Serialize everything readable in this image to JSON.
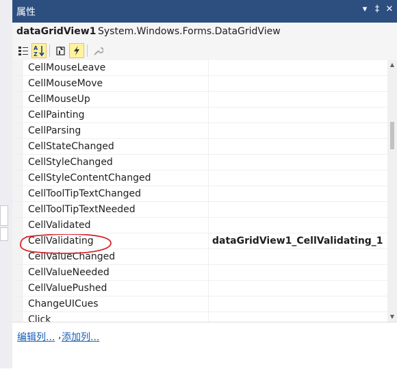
{
  "panel": {
    "title": "属性"
  },
  "window_controls": {
    "dropdown_glyph": "▾",
    "pin_glyph": "‡",
    "close_glyph": "✕"
  },
  "object_selector": {
    "name": "dataGridView1",
    "type": "System.Windows.Forms.DataGridView"
  },
  "toolbar": {
    "buttons": [
      "categorized-icon",
      "alphabetical-icon",
      "properties-icon",
      "events-icon",
      "property-pages-icon"
    ]
  },
  "events": [
    {
      "name": "CellMouseLeave",
      "value": ""
    },
    {
      "name": "CellMouseMove",
      "value": ""
    },
    {
      "name": "CellMouseUp",
      "value": ""
    },
    {
      "name": "CellPainting",
      "value": ""
    },
    {
      "name": "CellParsing",
      "value": ""
    },
    {
      "name": "CellStateChanged",
      "value": ""
    },
    {
      "name": "CellStyleChanged",
      "value": ""
    },
    {
      "name": "CellStyleContentChanged",
      "value": ""
    },
    {
      "name": "CellToolTipTextChanged",
      "value": ""
    },
    {
      "name": "CellToolTipTextNeeded",
      "value": ""
    },
    {
      "name": "CellValidated",
      "value": ""
    },
    {
      "name": "CellValidating",
      "value": "dataGridView1_CellValidating_1"
    },
    {
      "name": "CellValueChanged",
      "value": ""
    },
    {
      "name": "CellValueNeeded",
      "value": ""
    },
    {
      "name": "CellValuePushed",
      "value": ""
    },
    {
      "name": "ChangeUICues",
      "value": ""
    },
    {
      "name": "Click",
      "value": ""
    }
  ],
  "links": {
    "edit_columns": "编辑列...",
    "separator": ",",
    "add_column": "添加列..."
  },
  "colors": {
    "title_bar": "#2d4f80",
    "toolbar_checked": "#fff29d",
    "annotation": "#d9262b",
    "link": "#1a5fb4"
  }
}
